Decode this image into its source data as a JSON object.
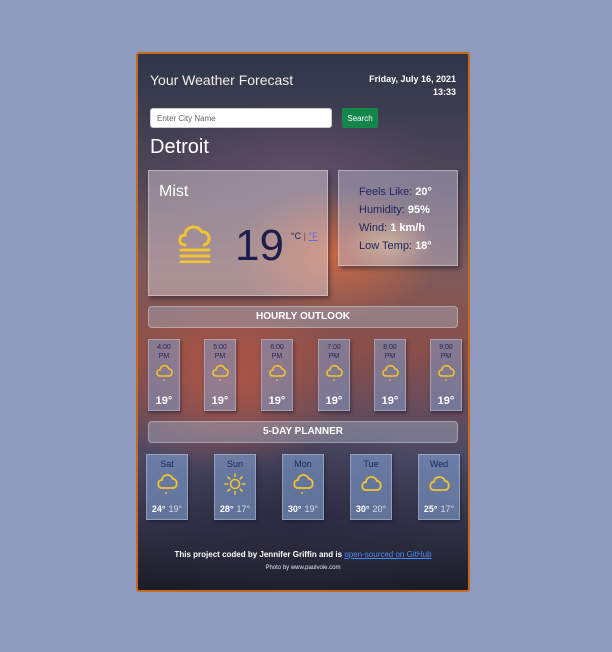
{
  "header": {
    "title": "Your Weather Forecast",
    "date": "Friday, July 16, 2021",
    "time": "13:33"
  },
  "search": {
    "placeholder": "Enter City Name",
    "value": "",
    "button_label": "Search"
  },
  "city": "Detroit",
  "current": {
    "condition": "Mist",
    "temperature": "19",
    "unit_c": "°C",
    "unit_separator": "|",
    "unit_f": "°F",
    "icon": "mist-icon"
  },
  "details": {
    "feels_like_label": "Feels Like:",
    "feels_like_value": "20°",
    "humidity_label": "Humidity:",
    "humidity_value": "95%",
    "wind_label": "Wind:",
    "wind_value": "1 km/h",
    "low_temp_label": "Low Temp:",
    "low_temp_value": "18°"
  },
  "hourly": {
    "heading": "HOURLY OUTLOOK",
    "items": [
      {
        "time": "4:00",
        "period": "PM",
        "temp": "19°",
        "icon": "cloud-rain-icon"
      },
      {
        "time": "5:00",
        "period": "PM",
        "temp": "19°",
        "icon": "cloud-rain-icon"
      },
      {
        "time": "6:00",
        "period": "PM",
        "temp": "19°",
        "icon": "cloud-rain-icon"
      },
      {
        "time": "7:00",
        "period": "PM",
        "temp": "19°",
        "icon": "cloud-rain-icon"
      },
      {
        "time": "8:00",
        "period": "PM",
        "temp": "19°",
        "icon": "cloud-rain-icon"
      },
      {
        "time": "9:00",
        "period": "PM",
        "temp": "19°",
        "icon": "cloud-rain-icon"
      }
    ]
  },
  "daily": {
    "heading": "5-DAY PLANNER",
    "items": [
      {
        "day": "Sat",
        "high": "24°",
        "low": "19°",
        "icon": "cloud-rain-icon"
      },
      {
        "day": "Sun",
        "high": "28°",
        "low": "17°",
        "icon": "sun-icon"
      },
      {
        "day": "Mon",
        "high": "30°",
        "low": "19°",
        "icon": "cloud-rain-icon"
      },
      {
        "day": "Tue",
        "high": "30°",
        "low": "20°",
        "icon": "cloud-icon"
      },
      {
        "day": "Wed",
        "high": "25°",
        "low": "17°",
        "icon": "cloud-icon"
      }
    ]
  },
  "footer": {
    "text": "This project coded by Jennifer Griffin and is",
    "link_text": "open-sourced on GitHub",
    "photo_credit": "Photo by www.paulvoie.com"
  },
  "colors": {
    "accent": "#15864a",
    "border": "#c46a1c",
    "icon": "#f4c430",
    "page_background": "#8f9bbd"
  }
}
